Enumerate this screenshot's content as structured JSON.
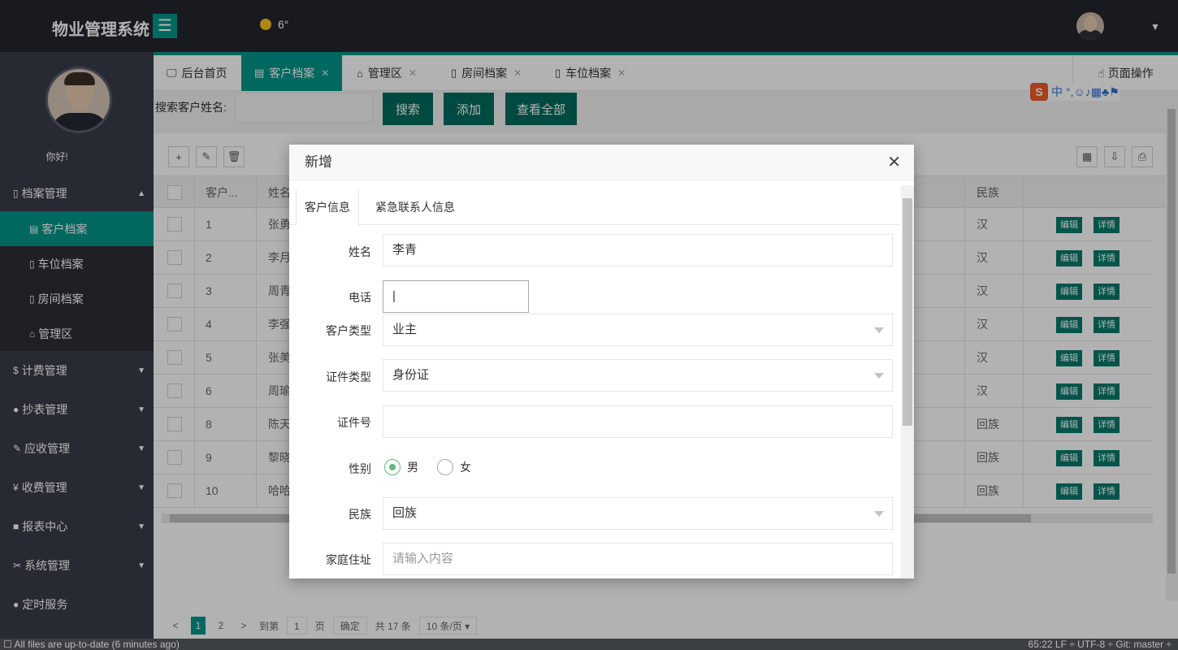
{
  "app": {
    "title": "物业管理系统",
    "menu_icon": "menu-icon",
    "weather_temp": "6°",
    "user_menu_arrow": "▼"
  },
  "sidebar": {
    "greeting": "你好!",
    "groups": [
      {
        "label": "档案管理",
        "icon": "▯",
        "expanded": true
      },
      {
        "label": "计费管理",
        "icon": "$"
      },
      {
        "label": "抄表管理",
        "icon": "●"
      },
      {
        "label": "应收管理",
        "icon": "✎"
      },
      {
        "label": "收费管理",
        "icon": "¥"
      },
      {
        "label": "报表中心",
        "icon": "■"
      },
      {
        "label": "系统管理",
        "icon": "✂"
      },
      {
        "label": "定时服务",
        "icon": "●"
      }
    ],
    "sub_items": [
      {
        "label": "客户档案",
        "active": true
      },
      {
        "label": "车位档案"
      },
      {
        "label": "房间档案"
      },
      {
        "label": "管理区"
      }
    ]
  },
  "tabs": [
    {
      "label": "后台首页",
      "icon": "monitor-icon",
      "closable": false
    },
    {
      "label": "客户档案",
      "icon": "document-icon",
      "closable": true,
      "active": true
    },
    {
      "label": "管理区",
      "icon": "home-icon",
      "closable": true
    },
    {
      "label": "房间档案",
      "icon": "document-icon",
      "closable": true
    },
    {
      "label": "车位档案",
      "icon": "document-icon",
      "closable": true
    }
  ],
  "page_ops": "页面操作",
  "search": {
    "label": "搜索客户姓名:",
    "search_btn": "搜索",
    "add_btn": "添加",
    "view_all_btn": "查看全部"
  },
  "table": {
    "headers": [
      "客户...",
      "姓名",
      "民族"
    ],
    "rows": [
      {
        "id": "1",
        "name": "张勇",
        "ethnic": "汉"
      },
      {
        "id": "2",
        "name": "李月",
        "ethnic": "汉"
      },
      {
        "id": "3",
        "name": "周青",
        "ethnic": "汉"
      },
      {
        "id": "4",
        "name": "李强",
        "ethnic": "汉"
      },
      {
        "id": "5",
        "name": "张美",
        "ethnic": "汉"
      },
      {
        "id": "6",
        "name": "周瑜",
        "ethnic": "汉"
      },
      {
        "id": "8",
        "name": "陈天",
        "ethnic": "回族"
      },
      {
        "id": "9",
        "name": "黎晓",
        "ethnic": "回族"
      },
      {
        "id": "10",
        "name": "哈哈",
        "ethnic": "回族"
      }
    ],
    "edit_btn": "编辑",
    "detail_btn": "详情"
  },
  "pager": {
    "prev": "<",
    "pages": [
      "1",
      "2"
    ],
    "current": "1",
    "next": ">",
    "goto_label": "到第",
    "goto_value": "1",
    "page_unit": "页",
    "confirm": "确定",
    "total": "共 17 条",
    "page_size": "10 条/页"
  },
  "modal": {
    "title": "新增",
    "close": "✕",
    "tabs": [
      "客户信息",
      "紧急联系人信息"
    ],
    "fields": {
      "name_label": "姓名",
      "name_value": "李青",
      "phone_label": "电话",
      "phone_value": "|",
      "customer_type_label": "客户类型",
      "customer_type_value": "业主",
      "id_type_label": "证件类型",
      "id_type_value": "身份证",
      "id_no_label": "证件号",
      "id_no_value": "",
      "gender_label": "性别",
      "gender_male": "男",
      "gender_female": "女",
      "gender_selected": "男",
      "ethnic_label": "民族",
      "ethnic_value": "回族",
      "address_label": "家庭住址",
      "address_placeholder": "请输入内容"
    }
  },
  "ime": {
    "logo": "S",
    "mode": "中"
  },
  "statusbar": {
    "left": "All files are up-to-date (6 minutes ago)",
    "right": "65:22  LF ÷  UTF-8 ÷  Git: master ÷"
  },
  "colors": {
    "accent": "#009688",
    "dark_button": "#006b5e",
    "topbar": "#23262e",
    "sidebar": "#393d49"
  }
}
